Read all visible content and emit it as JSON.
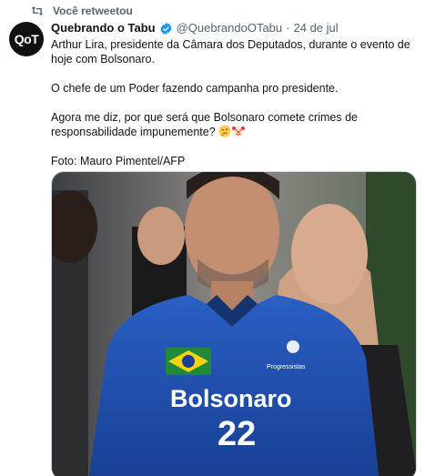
{
  "retweet": {
    "label": "Você retweetou",
    "icon": "retweet-icon"
  },
  "tweet": {
    "avatar_text": "QoT",
    "author_name": "Quebrando o Tabu",
    "verified_icon": "verified-badge-icon",
    "handle": "@QuebrandoOTabu",
    "separator": "·",
    "date": "24 de jul",
    "paragraphs": [
      "Arthur Lira, presidente da Câmara dos Deputados, durante o evento de hoje com Bolsonaro.",
      "O chefe de um Poder fazendo campanha pro presidente.",
      "Agora me diz, por que será que Bolsonaro comete crimes de responsabilidade impunemente?",
      "Foto: Mauro Pimentel/AFP"
    ],
    "emojis": [
      "thinking-face-icon",
      "clown-face-icon"
    ]
  },
  "photo": {
    "shirt_text": "Bolsonaro",
    "shirt_number": "22",
    "logo_text": "Progressistas",
    "colors": {
      "shirt_blue": "#1c4fb0",
      "flag_green": "#1f8a3a",
      "flag_yellow": "#f5d312"
    }
  }
}
